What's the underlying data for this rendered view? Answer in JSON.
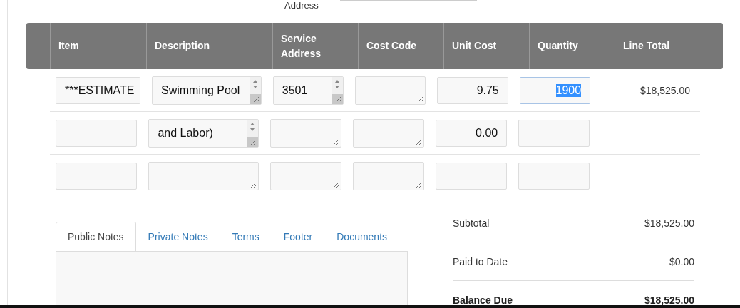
{
  "top_field": {
    "label": "Address"
  },
  "table": {
    "columns": [
      "Item",
      "Description",
      "Service Address",
      "Cost Code",
      "Unit Cost",
      "Quantity",
      "Line Total"
    ],
    "rows": [
      {
        "item": "***ESTIMATE",
        "description": "Swimming Pool",
        "service_address": "3501",
        "cost_code": "",
        "unit_cost": "9.75",
        "quantity": "1900",
        "quantity_selected": true,
        "line_total": "$18,525.00"
      },
      {
        "item": "",
        "description": "and Labor)",
        "service_address": "",
        "cost_code": "",
        "unit_cost": "0.00",
        "quantity": "",
        "quantity_selected": false,
        "line_total": ""
      },
      {
        "item": "",
        "description": "",
        "service_address": "",
        "cost_code": "",
        "unit_cost": "",
        "quantity": "",
        "quantity_selected": false,
        "line_total": ""
      }
    ]
  },
  "notes_tabs": [
    {
      "label": "Public Notes",
      "selected": true
    },
    {
      "label": "Private Notes",
      "selected": false
    },
    {
      "label": "Terms",
      "selected": false
    },
    {
      "label": "Footer",
      "selected": false
    },
    {
      "label": "Documents",
      "selected": false
    }
  ],
  "totals": [
    {
      "label": "Subtotal",
      "value": "$18,525.00",
      "bold": false
    },
    {
      "label": "Paid to Date",
      "value": "$0.00",
      "bold": false
    },
    {
      "label": "Balance Due",
      "value": "$18,525.00",
      "bold": true
    }
  ]
}
